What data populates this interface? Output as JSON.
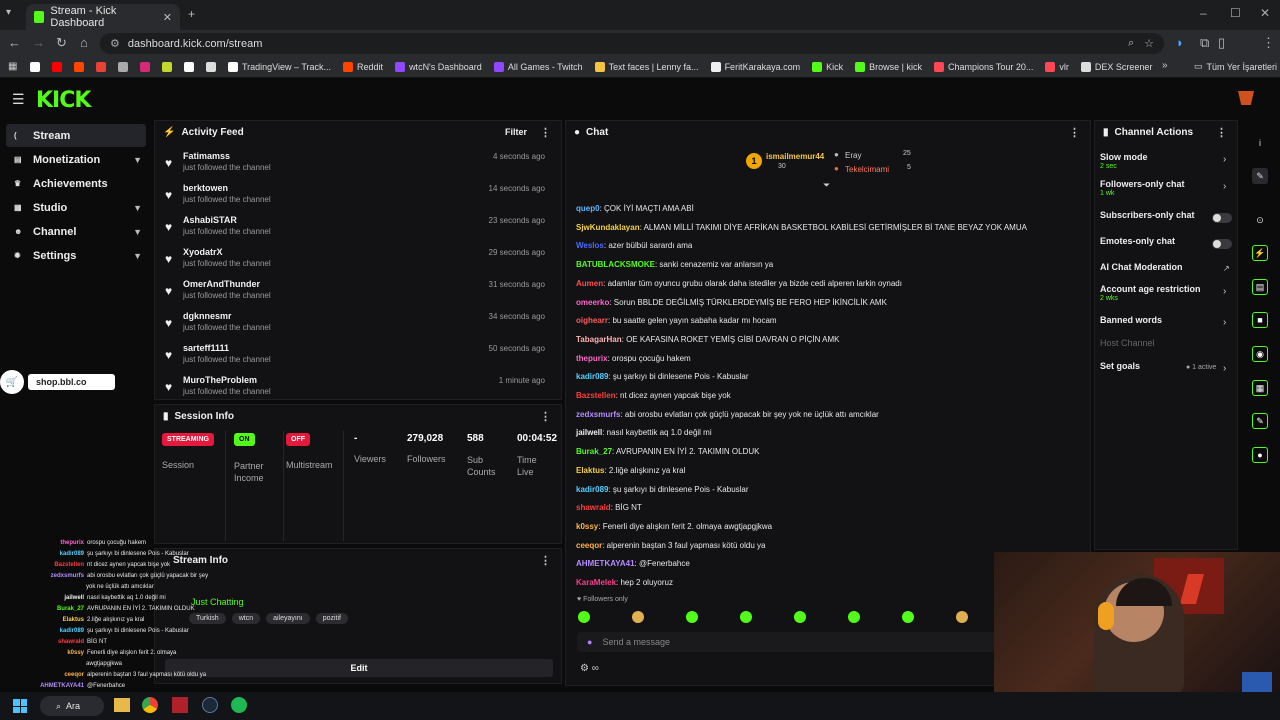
{
  "browser": {
    "tab_title": "Stream - Kick Dashboard",
    "url": "dashboard.kick.com/stream",
    "bookmarks": [
      {
        "label": "",
        "color": "#ffffff"
      },
      {
        "label": "",
        "color": "#ff0000"
      },
      {
        "label": "",
        "color": "#ff4500"
      },
      {
        "label": "",
        "color": "#ea4335"
      },
      {
        "label": "",
        "color": "#aaaaaa"
      },
      {
        "label": "",
        "color": "#d62976"
      },
      {
        "label": "",
        "color": "#c2d92c"
      },
      {
        "label": "",
        "color": "#ffffff"
      },
      {
        "label": "",
        "color": "#dddddd"
      },
      {
        "label": "TradingView – Track...",
        "color": "#ffffff"
      },
      {
        "label": "Reddit",
        "color": "#ff4500"
      },
      {
        "label": "wtcN's Dashboard",
        "color": "#9146ff"
      },
      {
        "label": "All Games - Twitch",
        "color": "#9146ff"
      },
      {
        "label": "Text faces | Lenny fa...",
        "color": "#f5c542"
      },
      {
        "label": "FeritKarakaya.com",
        "color": "#f0f0f0"
      },
      {
        "label": "Kick",
        "color": "#53fc18"
      },
      {
        "label": "Browse | kick",
        "color": "#53fc18"
      },
      {
        "label": "Champions Tour 20...",
        "color": "#ff4655"
      },
      {
        "label": "vlr",
        "color": "#ff4655"
      },
      {
        "label": "DEX Screener",
        "color": "#dddddd"
      }
    ],
    "bookmarks_more": "Tüm Yer İşaretleri"
  },
  "sidebar": {
    "items": [
      {
        "label": "Stream",
        "icon": "broadcast-icon",
        "active": true
      },
      {
        "label": "Monetization",
        "icon": "money-icon"
      },
      {
        "label": "Achievements",
        "icon": "trophy-icon"
      },
      {
        "label": "Studio",
        "icon": "studio-icon"
      },
      {
        "label": "Channel",
        "icon": "user-icon"
      },
      {
        "label": "Settings",
        "icon": "gear-icon"
      }
    ],
    "shop": "shop.bbl.co"
  },
  "activity": {
    "title": "Activity Feed",
    "filter": "Filter",
    "items": [
      {
        "name": "Fatimamss",
        "sub": "just followed the channel",
        "time": "4 seconds ago"
      },
      {
        "name": "berktowen",
        "sub": "just followed the channel",
        "time": "14 seconds ago"
      },
      {
        "name": "AshabiSTAR",
        "sub": "just followed the channel",
        "time": "23 seconds ago"
      },
      {
        "name": "XyodatrX",
        "sub": "just followed the channel",
        "time": "29 seconds ago"
      },
      {
        "name": "OmerAndThunder",
        "sub": "just followed the channel",
        "time": "31 seconds ago"
      },
      {
        "name": "dgknnesmr",
        "sub": "just followed the channel",
        "time": "34 seconds ago"
      },
      {
        "name": "sarteff1111",
        "sub": "just followed the channel",
        "time": "50 seconds ago"
      },
      {
        "name": "MuroTheProblem",
        "sub": "just followed the channel",
        "time": "1 minute ago"
      }
    ]
  },
  "session": {
    "title": "Session Info",
    "streaming": "STREAMING",
    "on": "ON",
    "off": "OFF",
    "labels": {
      "session": "Session",
      "partner": "Partner Income",
      "multistream": "Multistream",
      "viewers": "Viewers",
      "followers": "Followers",
      "subs": "Sub Counts",
      "time": "Time Live"
    },
    "viewers": "-",
    "followers": "279,028",
    "subs": "588",
    "time": "00:04:52"
  },
  "stream_info": {
    "title": "Stream Info",
    "category": "Just Chatting",
    "tags": [
      "Turkish",
      "wtcn",
      "aileyayını",
      "pozitif"
    ],
    "edit": "Edit"
  },
  "chat": {
    "title": "Chat",
    "top_gifters": [
      {
        "name": "ismailmemur44",
        "count": "30"
      },
      {
        "name": "Eray",
        "count": "25"
      },
      {
        "name": "Tekelcimami",
        "count": "5"
      }
    ],
    "messages": [
      {
        "user": "quep0",
        "color": "#5cb8ff",
        "text": "ÇOK İYİ MAÇTI AMA ABİ"
      },
      {
        "user": "SjwKundaklayan",
        "color": "#f5d142",
        "text": "ALMAN MİLLİ TAKIMI DİYE AFRİKAN BASKETBOL KABİLESİ GETİRMİŞLER Bİ TANE BEYAZ YOK AMUA"
      },
      {
        "user": "Weslos",
        "color": "#4b6bff",
        "text": "azer bülbül sarardı ama"
      },
      {
        "user": "BATUBLACKSMOKE",
        "color": "#53fc18",
        "text": "sanki cenazemiz var anlarsın ya"
      },
      {
        "user": "Aumen",
        "color": "#ff4d4d",
        "text": "adamlar tüm oyuncu grubu olarak daha istediler ya bizde cedi alperen larkin oynadı"
      },
      {
        "user": "omeerko",
        "color": "#ff66cc",
        "text": "Sorun BBLDE DEĞİLMİŞ TÜRKLERDEYMİŞ BE FERO HEP İKİNCİLİK AMK"
      },
      {
        "user": "oighearr",
        "color": "#ff5a5a",
        "text": "bu saatte gelen yayın sabaha kadar mı hocam"
      },
      {
        "user": "TabagarHan",
        "color": "#ffb3b3",
        "text": "OE KAFASINA ROKET YEMİŞ GİBİ DAVRAN O PİÇİN AMK"
      },
      {
        "user": "thepurix",
        "color": "#ff66cc",
        "text": "orospu çocuğu hakem"
      },
      {
        "user": "kadir089",
        "color": "#53d0ff",
        "text": "şu şarkıyı bi dinlesene Pois - Kabuslar"
      },
      {
        "user": "Bazstellen",
        "color": "#ff3d3d",
        "text": "nt dicez aynen yapcak bişe yok"
      },
      {
        "user": "zedxsmurfs",
        "color": "#b58cff",
        "text": "abi orosbu evlatları çok güçlü yapacak bir şey yok ne üçlük attı amcıklar"
      },
      {
        "user": "jailwell",
        "color": "#f0f0f0",
        "text": "nasıl kaybettik aq 1.0 değil mi"
      },
      {
        "user": "Burak_27",
        "color": "#53fc18",
        "text": "AVRUPANIN EN İYİ 2. TAKIMIN OLDUK"
      },
      {
        "user": "Elaktus",
        "color": "#f5d142",
        "text": "2.liğe alışkınız ya kral"
      },
      {
        "user": "kadir089",
        "color": "#53d0ff",
        "text": "şu şarkıyı bi dinlesene Pois - Kabuslar"
      },
      {
        "user": "shawrald",
        "color": "#ff3d3d",
        "text": "BİG NT"
      },
      {
        "user": "k0ssy",
        "color": "#ffb347",
        "text": "Fenerli diye alışkın ferit 2. olmaya awgtjapgjkwa"
      },
      {
        "user": "ceeqor",
        "color": "#ffb347",
        "text": "alperenin baştan 3 faul yapması kötü oldu ya"
      },
      {
        "user": "AHMETKAYA41",
        "color": "#b58cff",
        "text": "@Fenerbahce"
      },
      {
        "user": "KaraMelek",
        "color": "#ff3d8f",
        "text": "hep 2 oluyoruz"
      }
    ],
    "followers_only": "Followers only",
    "placeholder": "Send a message"
  },
  "actions": {
    "title": "Channel Actions",
    "items": [
      {
        "label": "Slow mode",
        "sub": "2 sec",
        "control": "arrow"
      },
      {
        "label": "Followers-only chat",
        "sub": "1 wk",
        "control": "arrow"
      },
      {
        "label": "Subscribers-only chat",
        "sub": "",
        "control": "toggle"
      },
      {
        "label": "Emotes-only chat",
        "sub": "",
        "control": "toggle"
      },
      {
        "label": "AI Chat Moderation",
        "sub": "",
        "control": "external"
      },
      {
        "label": "Account age restriction",
        "sub": "2 wks",
        "control": "arrow"
      },
      {
        "label": "Banned words",
        "sub": "",
        "control": "arrow"
      },
      {
        "label": "Host Channel",
        "sub": "",
        "control": "none"
      },
      {
        "label": "Set goals",
        "sub": "",
        "control": "arrow",
        "badge": "1 active"
      }
    ]
  },
  "overlay_chat": [
    {
      "user": "thepurix",
      "color": "#ff66cc",
      "text": "orospu çocuğu hakem"
    },
    {
      "user": "kadir089",
      "color": "#53d0ff",
      "text": "şu şarkıyı bi dinlesene Pois - Kabuslar"
    },
    {
      "user": "Bazstellen",
      "color": "#ff3d3d",
      "text": "nt dicez aynen yapcak bişe yok"
    },
    {
      "user": "zedxsmurfs",
      "color": "#b58cff",
      "text": "abi orosbu evlatları çok güçlü yapacak bir şey"
    },
    {
      "user": "",
      "color": "#ffffff",
      "text": "yok ne üçlük attı amcıklar"
    },
    {
      "user": "jailwell",
      "color": "#f0f0f0",
      "text": "nasıl kaybettik aq 1.0 değil mi"
    },
    {
      "user": "Burak_27",
      "color": "#53fc18",
      "text": "AVRUPANIN EN İYİ 2. TAKIMIN OLDUK"
    },
    {
      "user": "Elaktus",
      "color": "#f5d142",
      "text": "2.liğe alışkınız ya kral"
    },
    {
      "user": "kadir089",
      "color": "#53d0ff",
      "text": "şu şarkıyı bi dinlesene Pois - Kabuslar"
    },
    {
      "user": "shawrald",
      "color": "#ff3d3d",
      "text": "BİG NT"
    },
    {
      "user": "k0ssy",
      "color": "#ffb347",
      "text": "Fenerli diye alışkın ferit 2. olmaya"
    },
    {
      "user": "",
      "color": "#ffffff",
      "text": "awgtjapgjkwa"
    },
    {
      "user": "ceeqor",
      "color": "#ffb347",
      "text": "alperenin baştan 3 faul yapması kötü oldu ya"
    },
    {
      "user": "AHMETKAYA41",
      "color": "#b58cff",
      "text": "@Fenerbahce"
    },
    {
      "user": "KaraMelek",
      "color": "#ff3d8f",
      "text": "hep 2 oluyoruz"
    }
  ],
  "taskbar": {
    "search": "Ara"
  }
}
